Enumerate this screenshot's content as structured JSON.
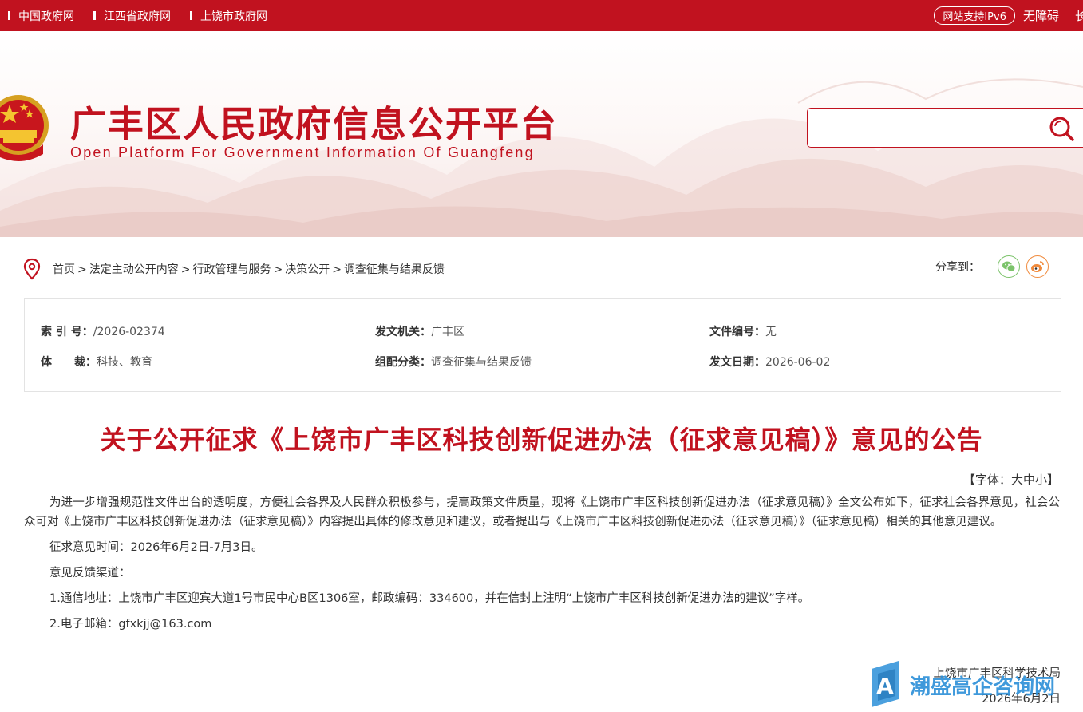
{
  "topbar": {
    "links": [
      "中国政府网",
      "江西省政府网",
      "上饶市政府网"
    ],
    "ipv6": "网站支持IPv6",
    "accessibility": "无障碍",
    "elder": "长辈"
  },
  "header": {
    "title": "广丰区人民政府信息公开平台",
    "subtitle": "Open Platform For Government Information Of Guangfeng",
    "search_placeholder": ""
  },
  "breadcrumb": [
    "首页",
    "法定主动公开内容",
    "行政管理与服务",
    "决策公开",
    "调查征集与结果反馈"
  ],
  "breadcrumb_sep": ">",
  "share": {
    "label": "分享到："
  },
  "meta": {
    "index_label": "索 引 号：",
    "index_value": "/2026-02374",
    "issuer_label": "发文机关：",
    "issuer_value": "广丰区",
    "doc_no_label": "文件编号：",
    "doc_no_value": "无",
    "genre_label": "体　　裁：",
    "genre_value": "科技、教育",
    "category_label": "组配分类：",
    "category_value": "调查征集与结果反馈",
    "date_label": "发文日期：",
    "date_value": "2026-06-02"
  },
  "article": {
    "title": "关于公开征求《上饶市广丰区科技创新促进办法（征求意见稿）》意见的公告",
    "font_size_label_open": "【字体：",
    "font_big": "大",
    "font_mid": "中",
    "font_small": "小",
    "font_size_label_close": "】",
    "paragraphs": [
      "为进一步增强规范性文件出台的透明度，方便社会各界及人民群众积极参与，提高政策文件质量，现将《上饶市广丰区科技创新促进办法（征求意见稿）》全文公布如下，征求社会各界意见，社会公众可对《上饶市广丰区科技创新促进办法（征求意见稿）》内容提出具体的修改意见和建议，或者提出与《上饶市广丰区科技创新促进办法（征求意见稿）》（征求意见稿）相关的其他意见建议。",
      "征求意见时间：2026年6月2日-7月3日。",
      "意见反馈渠道：",
      "1.通信地址：上饶市广丰区迎宾大道1号市民中心B区1306室，邮政编码：334600，并在信封上注明“上饶市广丰区科技创新促进办法的建议”字样。",
      "2.电子邮箱：gfxkjj@163.com"
    ],
    "signer": "上饶市广丰区科学技术局",
    "sign_date": "2026年6月2日"
  },
  "watermark": {
    "text": "潮盛高企咨询网",
    "letter": "A"
  },
  "colors": {
    "brand_red": "#c1121f",
    "wechat_green": "#7cc36b",
    "weibo_orange": "#f08a3c",
    "watermark_blue": "#2b8fd8"
  }
}
